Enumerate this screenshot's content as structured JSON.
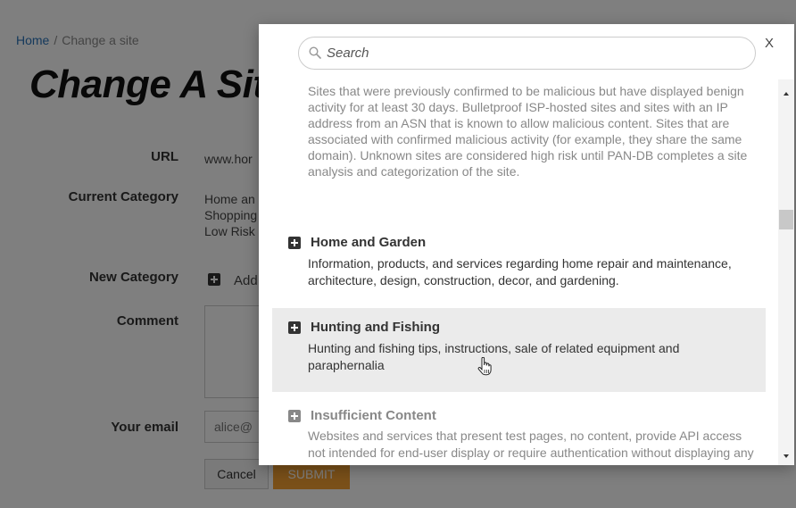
{
  "breadcrumb": {
    "home": "Home",
    "separator": "/",
    "current": "Change a site"
  },
  "page": {
    "title": "Change A Sit",
    "fields": {
      "url_label": "URL",
      "url_value": "www.hor",
      "current_category_label": "Current Category",
      "current_category_lines": [
        "Home an",
        "Shopping",
        "Low Risk"
      ],
      "new_category_label": "New Category",
      "add_label": "Add",
      "comment_label": "Comment",
      "email_label": "Your email",
      "email_value": "alice@",
      "cancel_label": "Cancel",
      "submit_label": "SUBMIT"
    }
  },
  "modal": {
    "search_placeholder": "Search",
    "close_label": "X",
    "top_description": "Sites that were previously confirmed to be malicious but have displayed benign activity for at least 30 days. Bulletproof ISP-hosted sites and sites with an IP address from an ASN that is known to allow malicious content. Sites that are associated with confirmed malicious activity (for example, they share the same domain). Unknown sites are considered high risk until PAN-DB completes a site analysis and categorization of the site.",
    "categories": [
      {
        "name": "Home and Garden",
        "description": "Information, products, and services regarding home repair and maintenance, architecture, design, construction, decor, and gardening."
      },
      {
        "name": "Hunting and Fishing",
        "description": "Hunting and fishing tips, instructions, sale of related equipment and paraphernalia"
      },
      {
        "name": "Insufficient Content",
        "description": "Websites and services that present test pages, no content, provide API access not intended for end-user display or require authentication without displaying any other content suggesting a different"
      }
    ]
  },
  "colors": {
    "accent_link": "#2a73b8",
    "submit_button": "#f5a032",
    "hover_row": "#ebebeb"
  }
}
